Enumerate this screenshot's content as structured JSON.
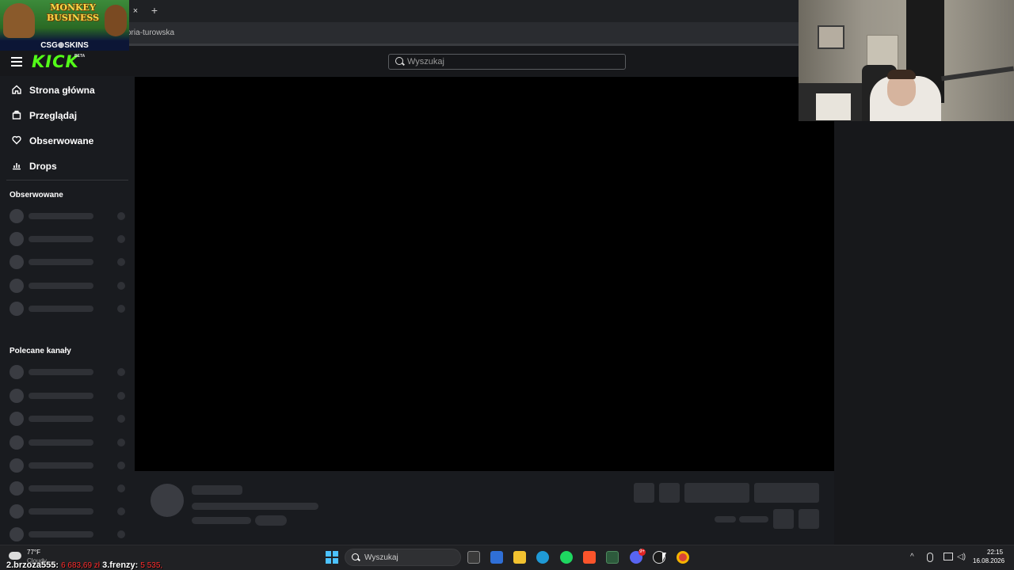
{
  "browser": {
    "tab_close": "×",
    "new_tab": "+",
    "url_partial": "oria-turowska"
  },
  "ad": {
    "title_line1": "MONKEY",
    "title_line2": "BUSINESS",
    "brand": "CSG⊕SKINS"
  },
  "header": {
    "logo": "KICK",
    "beta": "BETA",
    "search_placeholder": "Wyszukaj"
  },
  "sidebar": {
    "nav": [
      {
        "label": "Strona główna",
        "icon": "home-icon"
      },
      {
        "label": "Przeglądaj",
        "icon": "browse-icon"
      },
      {
        "label": "Obserwowane",
        "icon": "heart-icon"
      },
      {
        "label": "Drops",
        "icon": "drops-icon"
      }
    ],
    "following_heading": "Obserwowane",
    "recommended_heading": "Polecane kanały"
  },
  "taskbar": {
    "weather_temp": "77°F",
    "weather_cond": "Cloudy",
    "ticker_p2": "2.brzoza555:",
    "ticker_v2": "6 683,69 zł",
    "ticker_p3": "3.frenzy:",
    "ticker_v3": "5 535,",
    "search_placeholder": "Wyszukaj",
    "discord_badge": "9+",
    "time": "22:15",
    "date": "16.08.2026"
  },
  "colors": {
    "kick_green": "#53fc18",
    "background": "#191b1f",
    "player": "#000000",
    "skeleton": "#2f3136",
    "ticker_red": "#ff2b2b"
  }
}
